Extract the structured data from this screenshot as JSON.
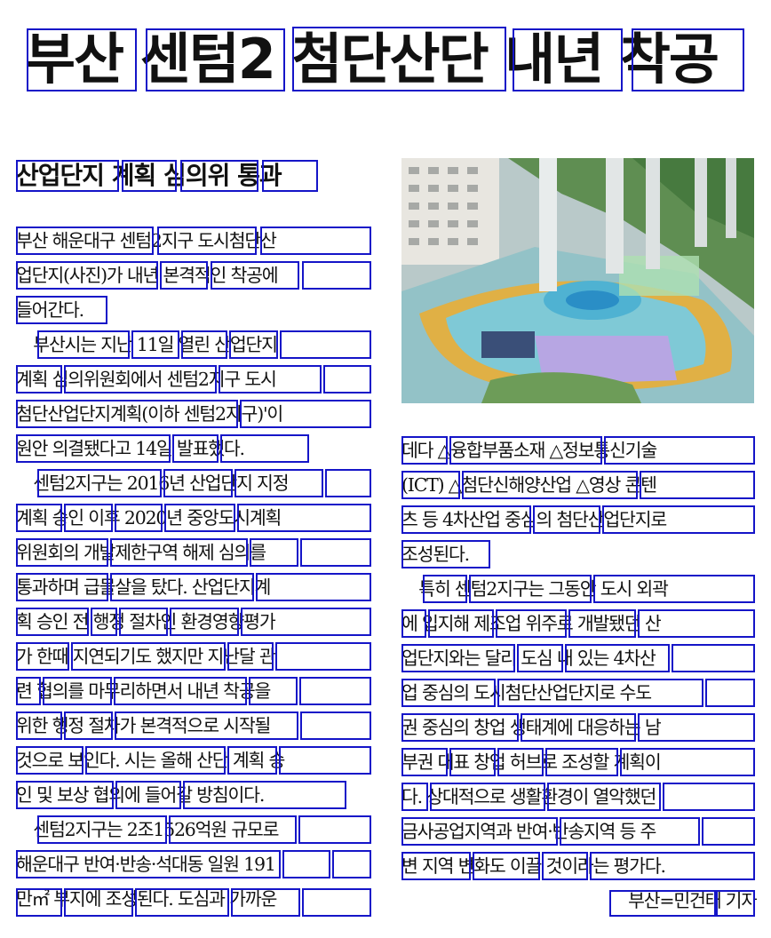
{
  "headline": "부산 센텀2 첨단산단 내년 착공",
  "subhead": "산업단지 계획 심의위 통과",
  "left_lines": [
    "부산 해운대구 센텀2지구 도시첨단산",
    "업단지(사진)가 내년 본격적인 착공에",
    "들어간다.",
    "　부산시는 지난 11일 열린 산업단지",
    "계획 심의위원회에서 센텀2지구 도시",
    "첨단산업단지계획(이하 센텀2지구)'이",
    "원안 의결됐다고 14일 발표했다.",
    "　센텀2지구는 2016년 산업단지 지정",
    "계획 승인 이후 2020년 중앙도시계획",
    "위원회의 개발제한구역 해제 심의를",
    "통과하며 급물살을 탔다. 산업단지계",
    "획 승인 전 행정 절차인 환경영향평가",
    "가 한때 지연되기도 했지만 지난달 관",
    "련 협의를 마무리하면서 내년 착공을",
    "위한 행정 절차가 본격적으로 시작될",
    "것으로 보인다. 시는 올해 산단 계획 승",
    "인 및 보상 협의에 들어갈 방침이다.",
    "　센텀2지구는 2조1526억원 규모로",
    "해운대구 반여·반송·석대동 일원 191",
    "만㎡ 부지에 조성된다. 도심과 가까운"
  ],
  "right_lines": [
    "데다 △융합부품소재 △정보통신기술",
    "(ICT) △첨단신해양산업 △영상 콘텐",
    "츠 등 4차산업 중심의 첨단산업단지로",
    "조성된다.",
    "　특히 센텀2지구는 그동안 도시 외곽",
    "에 입지해 제조업 위주로 개발됐던 산",
    "업단지와는 달리 도심 내 있는 4차산",
    "업 중심의 도시첨단산업단지로 수도",
    "권 중심의 창업 생태계에 대응하는 남",
    "부권 대표 창업 허브로 조성할 계획이",
    "다. 상대적으로 생활환경이 열악했던",
    "금사공업지역과 반여·반송지역 등 주",
    "변 지역 변화도 이끌 것이라는 평가다."
  ],
  "byline": "부산=민건태 기자",
  "photo": {
    "icon": "aerial-park-photo"
  }
}
